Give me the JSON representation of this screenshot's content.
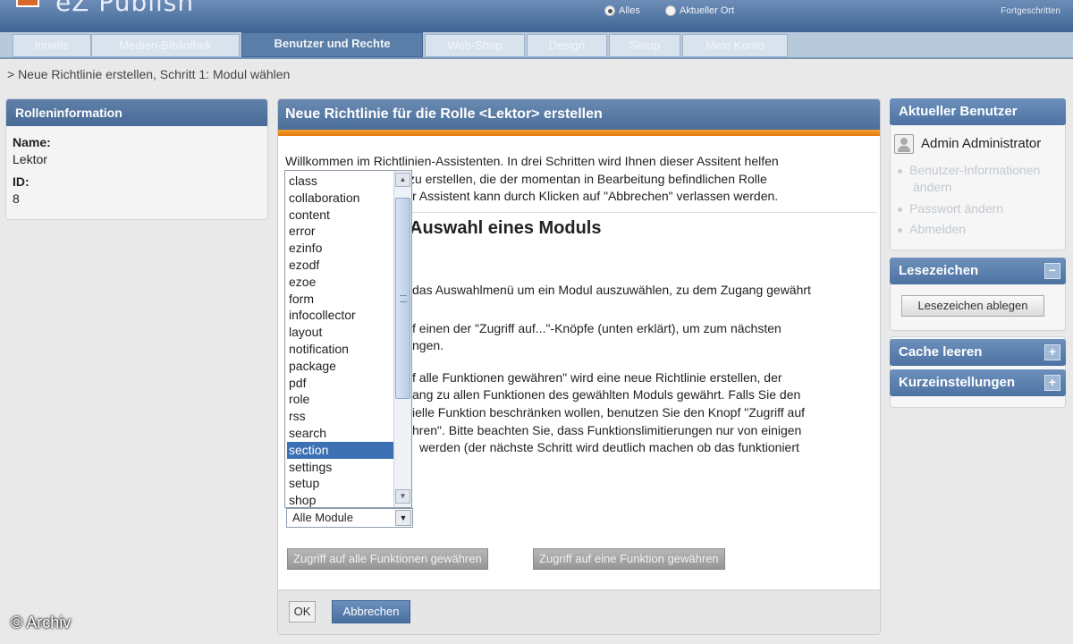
{
  "header": {
    "logo_text": "eZ Publish",
    "scope_all": "Alles",
    "scope_current": "Aktueller Ort",
    "advanced": "Fortgeschritten"
  },
  "tabs": [
    {
      "label": "Inhalte"
    },
    {
      "label": "Medien-Bibliothek"
    },
    {
      "label": "Benutzer und Rechte"
    },
    {
      "label": "Web-Shop"
    },
    {
      "label": "Design"
    },
    {
      "label": "Setup"
    },
    {
      "label": "Mein Konto"
    }
  ],
  "breadcrumb": "> Neue Richtlinie erstellen, Schritt 1: Modul wählen",
  "role_info": {
    "title": "Rolleninformation",
    "name_label": "Name:",
    "name_value": "Lektor",
    "id_label": "ID:",
    "id_value": "8"
  },
  "main": {
    "title": "Neue Richtlinie für die Rolle <Lektor> erstellen",
    "intro_line1": "Willkommen im Richtlinien-Assistenten. In drei Schritten wird Ihnen dieser Assitent helfen",
    "intro_line2": "zu erstellen, die der momentan in Bearbeitung befindlichen Rolle",
    "intro_line3": "r Assistent kann durch Klicken auf \"Abbrechen\" verlassen werden.",
    "heading": "Auswahl eines Moduls",
    "p1": "das Auswahlmenü um ein Modul auszuwählen, zu dem Zugang gewährt",
    "p2_line1": "f einen der \"Zugriff auf...\"-Knöpfe (unten erklärt), um zum nächsten",
    "p2_line2": "ngen.",
    "p3_line1": "f alle Funktionen gewähren\" wird eine neue Richtlinie erstellen, der",
    "p3_line2": "ang zu allen Funktionen des gewählten Moduls gewährt. Falls Sie den",
    "p3_line3": "ielle Funktion beschränken wollen, benutzen Sie den Knopf \"Zugriff auf",
    "p3_line4": "hren\". Bitte beachten Sie, dass Funktionslimitierungen nur von einigen",
    "p3_line5": "werden (der nächste Schritt wird deutlich machen ob das funktioniert",
    "btn_all": "Zugriff auf alle Funktionen gewähren",
    "btn_one": "Zugriff auf eine Funktion gewähren",
    "btn_ok": "OK",
    "btn_cancel": "Abbrechen"
  },
  "module_list": {
    "items": [
      "class",
      "collaboration",
      "content",
      "error",
      "ezinfo",
      "ezodf",
      "ezoe",
      "form",
      "infocollector",
      "layout",
      "notification",
      "package",
      "pdf",
      "role",
      "rss",
      "search",
      "section",
      "settings",
      "setup",
      "shop"
    ],
    "selected": "section",
    "select_value": "Alle Module"
  },
  "right": {
    "current_user_title": "Aktueller Benutzer",
    "user_name": "Admin Administrator",
    "link_user_info_1": "Benutzer-Informationen",
    "link_user_info_2": "ändern",
    "link_password": "Passwort ändern",
    "link_logout": "Abmelden",
    "bookmarks_title": "Lesezeichen",
    "bookmarks_button": "Lesezeichen ablegen",
    "cache_title": "Cache leeren",
    "quick_title": "Kurzeinstellungen"
  },
  "watermark": "© Archiv"
}
